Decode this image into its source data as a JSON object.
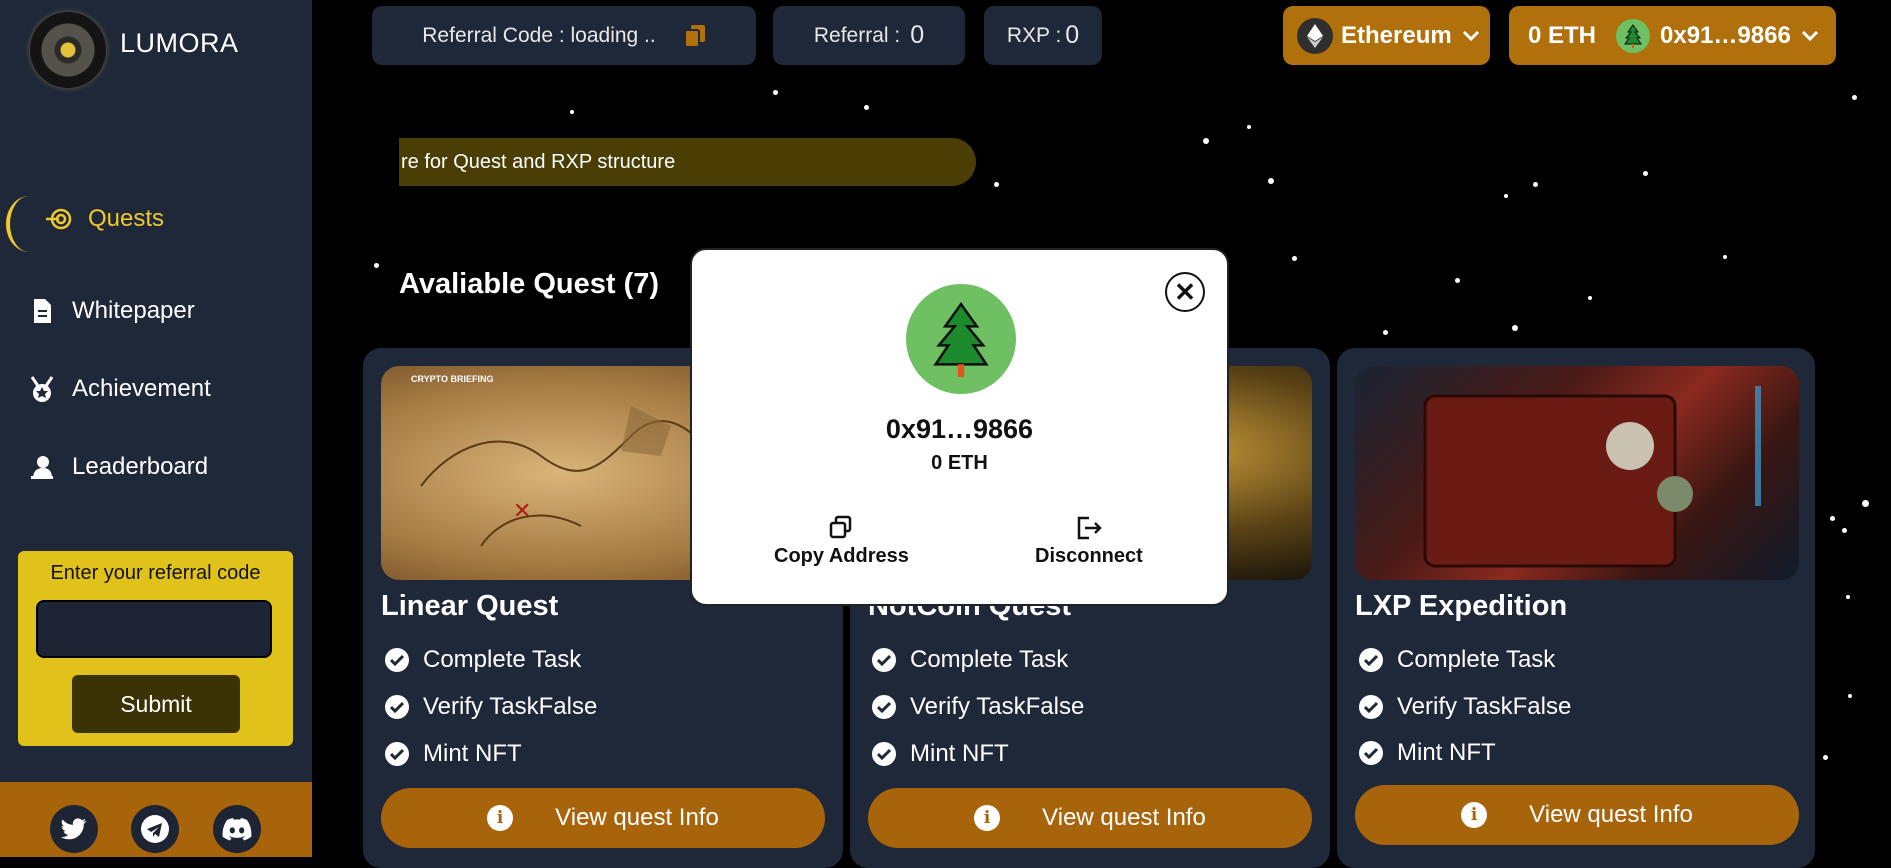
{
  "app": {
    "name": "LUMORA"
  },
  "sidebar": {
    "items": [
      {
        "label": "Quests",
        "icon": "quest-target-icon",
        "active": true
      },
      {
        "label": "Whitepaper",
        "icon": "document-icon",
        "active": false
      },
      {
        "label": "Achievement",
        "icon": "medal-icon",
        "active": false
      },
      {
        "label": "Leaderboard",
        "icon": "leaderboard-icon",
        "active": false
      }
    ],
    "referral": {
      "label": "Enter your referral code",
      "input_value": "",
      "submit_label": "Submit"
    },
    "social": [
      "twitter-icon",
      "telegram-icon",
      "discord-icon"
    ]
  },
  "topbar": {
    "referral_code": {
      "label": "Referral Code : loading .."
    },
    "referral_count": {
      "label": "Referral :",
      "value": "0"
    },
    "rxp": {
      "label": "RXP :",
      "value": "0"
    },
    "network": {
      "label": "Ethereum"
    },
    "wallet": {
      "balance": "0 ETH",
      "address": "0x91…9866"
    }
  },
  "banner": {
    "text": "re for Quest and RXP structure"
  },
  "quests": {
    "heading": "Avaliable Quest (7)",
    "cards": [
      {
        "title": "Linear Quest",
        "tasks": [
          "Complete Task",
          "Verify TaskFalse",
          "Mint NFT"
        ],
        "button": "View quest Info",
        "image_badge": "CRYPTO BRIEFING"
      },
      {
        "title": "NotCoin Quest",
        "tasks": [
          "Complete Task",
          "Verify TaskFalse",
          "Mint NFT"
        ],
        "button": "View quest Info"
      },
      {
        "title": "LXP Expedition",
        "tasks": [
          "Complete Task",
          "Verify TaskFalse",
          "Mint NFT"
        ],
        "button": "View quest Info"
      }
    ]
  },
  "modal": {
    "address": "0x91…9866",
    "balance": "0 ETH",
    "copy_label": "Copy Address",
    "disconnect_label": "Disconnect"
  },
  "colors": {
    "sidebar_bg": "#1e2838",
    "accent_gold": "#b0700c",
    "accent_yellow": "#efc92c",
    "referral_box": "#e1c21b"
  }
}
